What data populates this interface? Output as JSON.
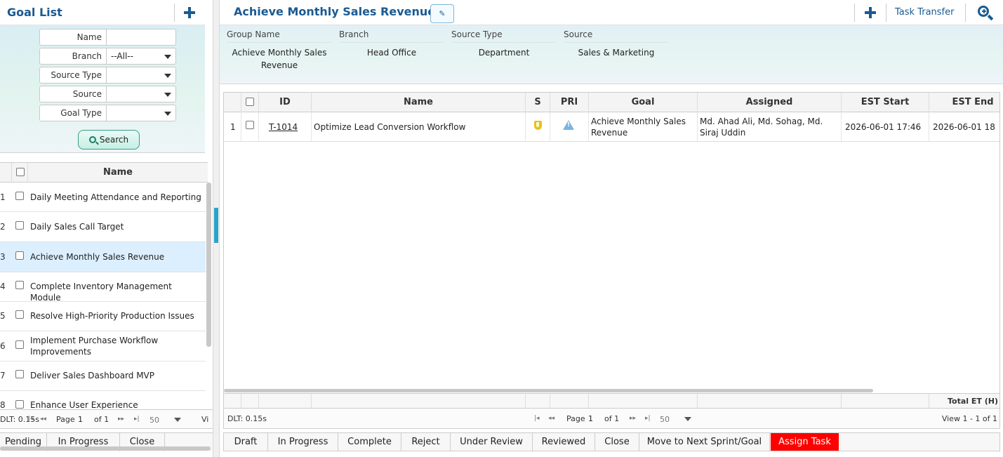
{
  "left_panel": {
    "title": "Goal List",
    "filters": [
      {
        "label": "Name",
        "value": ""
      },
      {
        "label": "Branch",
        "value": "--All--"
      },
      {
        "label": "Source Type",
        "value": ""
      },
      {
        "label": "Source",
        "value": ""
      },
      {
        "label": "Goal Type",
        "value": ""
      }
    ],
    "search_label": "Search",
    "grid_header": "Name",
    "rows": [
      {
        "num": "1",
        "name": "Daily Meeting Attendance and Reporting"
      },
      {
        "num": "2",
        "name": "Daily Sales Call Target"
      },
      {
        "num": "3",
        "name": "Achieve Monthly Sales Revenue"
      },
      {
        "num": "4",
        "name": "Complete Inventory Management Module"
      },
      {
        "num": "5",
        "name": "Resolve High-Priority Production Issues"
      },
      {
        "num": "6",
        "name": "Implement Purchase Workflow Improvements"
      },
      {
        "num": "7",
        "name": "Deliver Sales Dashboard MVP"
      },
      {
        "num": "8",
        "name": "Enhance User Experience"
      }
    ],
    "pager": {
      "dlt": "DLT: 0.15s",
      "page_label": "Page",
      "page": "1",
      "of": "of 1",
      "size": "50",
      "view": "Vi"
    },
    "actions": [
      "Pending",
      "In Progress",
      "Close"
    ]
  },
  "right_panel": {
    "title": "Achieve Monthly Sales Revenue",
    "task_transfer": "Task Transfer",
    "info": [
      {
        "label": "Group Name",
        "value": "Achieve Monthly Sales Revenue"
      },
      {
        "label": "Branch",
        "value": "Head Office"
      },
      {
        "label": "Source Type",
        "value": "Department"
      },
      {
        "label": "Source",
        "value": "Sales & Marketing"
      }
    ],
    "columns": [
      "ID",
      "Name",
      "S",
      "PRI",
      "Goal",
      "Assigned",
      "EST Start",
      "EST End"
    ],
    "rows": [
      {
        "num": "1",
        "id": "T-1014",
        "name": "Optimize Lead Conversion Workflow",
        "status_icon": "shield-icon",
        "priority_icon": "warning-icon",
        "goal": "Achieve Monthly Sales Revenue",
        "assigned": "Md. Ahad Ali, Md. Sohag, Md. Siraj Uddin",
        "est_start": "2026-06-01 17:46",
        "est_end": "2026-06-01 18"
      }
    ],
    "total_et": "Total ET (H)",
    "pager": {
      "dlt": "DLT: 0.15s",
      "page_label": "Page",
      "page": "1",
      "of": "of 1",
      "size": "50",
      "view": "View 1 - 1 of 1"
    },
    "actions": [
      "Draft",
      "In Progress",
      "Complete",
      "Reject",
      "Under Review",
      "Reviewed",
      "Close",
      "Move to Next Sprint/Goal",
      "Assign Task"
    ]
  },
  "colors": {
    "accent": "#1a5a92",
    "assign_task": "#ff0000",
    "selected_row": "#dcefff"
  }
}
